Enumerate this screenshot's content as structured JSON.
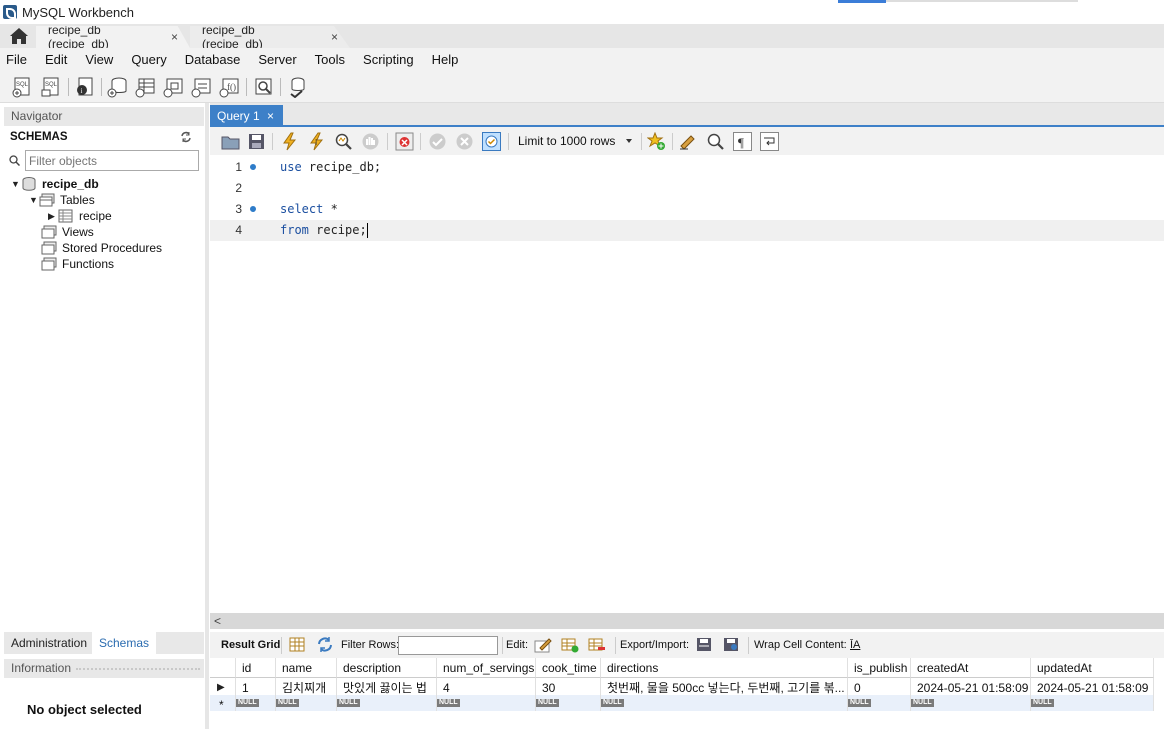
{
  "window": {
    "title": "MySQL Workbench"
  },
  "tabs": [
    {
      "label": "recipe_db (recipe_db)",
      "close": "×"
    },
    {
      "label": "recipe_db (recipe_db)",
      "close": "×"
    }
  ],
  "menu": [
    "File",
    "Edit",
    "View",
    "Query",
    "Database",
    "Server",
    "Tools",
    "Scripting",
    "Help"
  ],
  "navigator": {
    "header": "Navigator",
    "schemas_title": "SCHEMAS",
    "filter_placeholder": "Filter objects",
    "tree": {
      "schema": "recipe_db",
      "tables": "Tables",
      "table": "recipe",
      "views": "Views",
      "procedures": "Stored Procedures",
      "functions": "Functions"
    },
    "bottom_tabs": [
      "Administration",
      "Schemas"
    ],
    "info_header": "Information",
    "info_text": "No object selected"
  },
  "editor": {
    "tab": "Query 1",
    "tab_close": "×",
    "limit": "Limit to 1000 rows",
    "lines": [
      {
        "num": "1",
        "kw": "use",
        "rest": " recipe_db;"
      },
      {
        "num": "2",
        "kw": "",
        "rest": ""
      },
      {
        "num": "3",
        "kw": "select",
        "rest": " *"
      },
      {
        "num": "4",
        "kw": "from",
        "rest": " recipe;"
      }
    ],
    "hscroll_arrow": "<"
  },
  "result": {
    "grid_label": "Result Grid",
    "filter_label": "Filter Rows:",
    "edit_label": "Edit:",
    "export_label": "Export/Import:",
    "wrap_label": "Wrap Cell Content:",
    "wrap_icon_text": "ĪA",
    "null_label": "NULL",
    "columns": [
      "id",
      "name",
      "description",
      "num_of_servings",
      "cook_time",
      "directions",
      "is_publish",
      "createdAt",
      "updatedAt"
    ],
    "rows": [
      [
        "1",
        "김치찌개",
        "맛있게 끓이는 법",
        "4",
        "30",
        "첫번째, 물을 500cc 넣는다, 두번째, 고기를 볶...",
        "0",
        "2024-05-21 01:58:09",
        "2024-05-21 01:58:09"
      ]
    ],
    "new_row_marker": "*"
  },
  "colors": {
    "accent": "#3d80c8",
    "keyword": "#1b4fa0",
    "dot": "#2e7cc9"
  }
}
